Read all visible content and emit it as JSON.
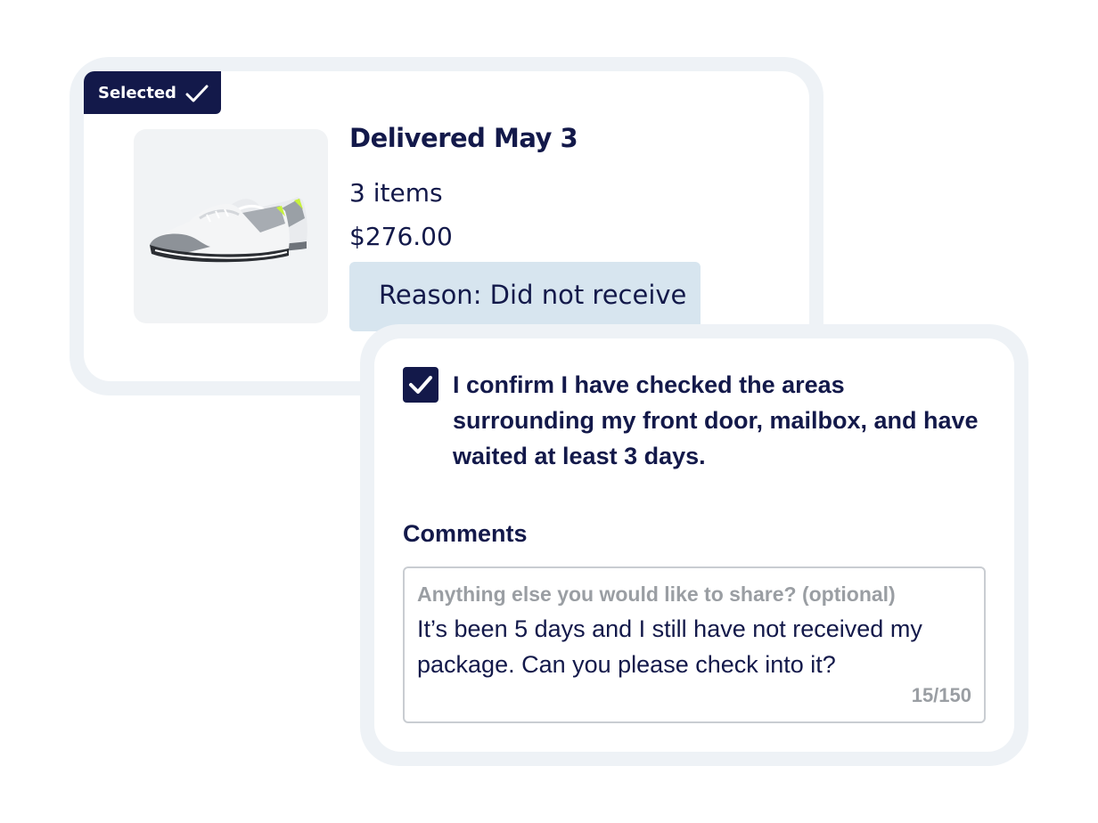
{
  "order_card": {
    "badge_label": "Selected",
    "badge_icon": "checkmark-icon",
    "product_image": "sneaker-image",
    "delivery_status": "Delivered May 3",
    "item_count": "3 items",
    "total": "$276.00",
    "reason": "Reason: Did not receive"
  },
  "confirmation": {
    "checked": true,
    "checkbox_icon": "checkmark-icon",
    "text": "I confirm I have checked the areas surrounding my front door, mailbox, and have waited at least 3 days."
  },
  "comments": {
    "label": "Comments",
    "placeholder": "Anything else you would like to share? (optional)",
    "value": "It’s been 5 days and I still have not received my package. Can you please check into it?",
    "counter": "15/150"
  },
  "colors": {
    "navy": "#13194a",
    "frame": "#eef2f6",
    "reason_bg": "#d7e5ef",
    "muted": "#9a9ea3"
  }
}
